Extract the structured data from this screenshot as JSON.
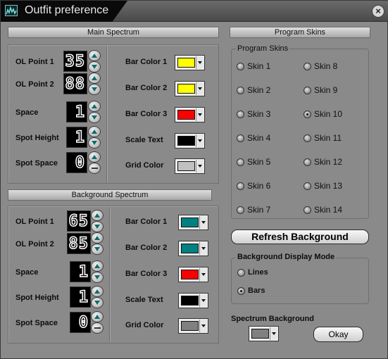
{
  "window": {
    "title": "Outfit preference",
    "close_label": "×"
  },
  "main_spectrum": {
    "header": "Main Spectrum",
    "rows": [
      {
        "label": "OL Point 1",
        "value": "35"
      },
      {
        "label": "OL Point 2",
        "value": "88"
      },
      {
        "label": "Space",
        "value": "1"
      },
      {
        "label": "Spot Height",
        "value": "1"
      },
      {
        "label": "Spot Space",
        "value": "0"
      }
    ],
    "colors": [
      {
        "label": "Bar Color 1",
        "color": "#ffff00"
      },
      {
        "label": "Bar Color 2",
        "color": "#ffff00"
      },
      {
        "label": "Bar Color 3",
        "color": "#ff0000"
      },
      {
        "label": "Scale Text",
        "color": "#000000"
      },
      {
        "label": "Grid Color",
        "color": "#c0c0c0"
      }
    ]
  },
  "background_spectrum": {
    "header": "Background Spectrum",
    "rows": [
      {
        "label": "OL Point 1",
        "value": "65"
      },
      {
        "label": "OL Point 2",
        "value": "85"
      },
      {
        "label": "Space",
        "value": "1"
      },
      {
        "label": "Spot Height",
        "value": "1"
      },
      {
        "label": "Spot Space",
        "value": "0"
      }
    ],
    "colors": [
      {
        "label": "Bar Color 1",
        "color": "#008080"
      },
      {
        "label": "Bar Color 2",
        "color": "#008080"
      },
      {
        "label": "Bar Color 3",
        "color": "#ff0000"
      },
      {
        "label": "Scale Text",
        "color": "#000000"
      },
      {
        "label": "Grid Color",
        "color": "#808080"
      }
    ]
  },
  "program_skins": {
    "header": "Program Skins",
    "group_title": "Program Skins",
    "selected": "Skin 10",
    "skins": [
      "Skin 1",
      "Skin 2",
      "Skin 3",
      "Skin 4",
      "Skin 5",
      "Skin 6",
      "Skin 7",
      "Skin 8",
      "Skin 9",
      "Skin 10",
      "Skin 11",
      "Skin 12",
      "Skin 13",
      "Skin  14"
    ]
  },
  "refresh_button": "Refresh Background",
  "display_mode": {
    "title": "Background Display Mode",
    "options": [
      "Lines",
      "Bars"
    ],
    "selected": "Bars"
  },
  "spectrum_background": {
    "label": "Spectrum Background",
    "color": "#808080"
  },
  "okay_button": "Okay"
}
